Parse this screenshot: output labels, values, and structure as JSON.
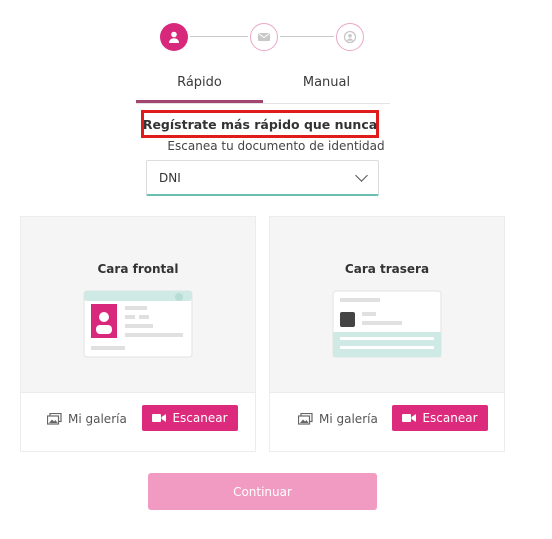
{
  "stepper": {
    "steps": [
      "user-icon",
      "mail-icon",
      "account-icon"
    ],
    "active_index": 0
  },
  "tabs": [
    {
      "label": "Rápido",
      "active": true
    },
    {
      "label": "Manual",
      "active": false
    }
  ],
  "headline": "Regístrate más rápido que nunca",
  "subtitle": "Escanea tu documento de identidad",
  "document_select": {
    "value": "DNI"
  },
  "cards": [
    {
      "title": "Cara frontal",
      "gallery_label": "Mi galería",
      "scan_label": "Escanear"
    },
    {
      "title": "Cara trasera",
      "gallery_label": "Mi galería",
      "scan_label": "Escanear"
    }
  ],
  "continue_label": "Continuar",
  "colors": {
    "accent": "#dc2a7d",
    "highlight_border": "#e01b1b",
    "continue_disabled": "#f29bc2",
    "teal": "#6bbfb0"
  }
}
